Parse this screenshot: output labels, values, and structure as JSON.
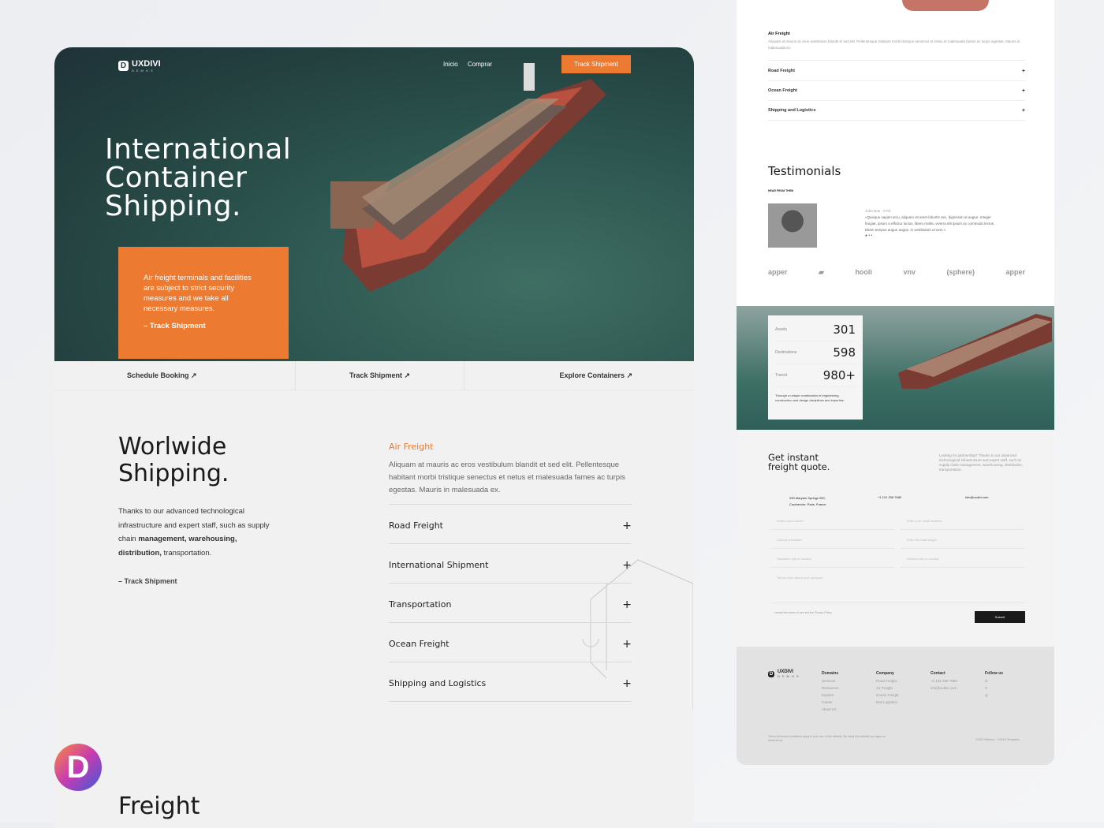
{
  "brand": {
    "name": "UXDIVI",
    "sub": "DEMOS"
  },
  "nav": {
    "items": [
      "Inicio",
      "Comprar"
    ],
    "cta": "Track Shipment"
  },
  "hero": {
    "title": [
      "International",
      "Container",
      "Shipping."
    ],
    "card_text": "Air freight terminals and facilities are subject to strict security measures and we take all necessary measures.",
    "card_link": "– Track Shipment"
  },
  "quick_links": [
    "Schedule Booking ↗",
    "Track Shipment ↗",
    "Explore Containers ↗"
  ],
  "worldwide": {
    "title": [
      "Worlwide",
      "Shipping."
    ],
    "text_pre": "Thanks to our advanced technological infrastructure and expert staff, such as supply chain ",
    "text_bold1": "management, warehousing, distribution,",
    "text_post": " transportation.",
    "link": "– Track Shipment"
  },
  "services": {
    "active": {
      "title": "Air Freight",
      "text": "Aliquam at mauris ac eros vestibulum blandit et sed elit. Pellentesque habitant morbi tristique senectus et netus et malesuada fames ac turpis egestas. Mauris in malesuada ex."
    },
    "items": [
      "Road Freight",
      "International Shipment",
      "Transportation",
      "Ocean Freight",
      "Shipping and Logistics"
    ]
  },
  "freight_heading": "Freight",
  "preview": {
    "accordion": {
      "active": "Air Freight",
      "text": "Aliquam at mauris ac eros vestibulum blandit et sed elit. Pellentesque habitant morbi tristique senectus et netus et malesuada fames ac turpis egestas. Mauris in malesuada ex.",
      "items": [
        "Road Freight",
        "Ocean Freight",
        "Shipping and Logistics"
      ]
    },
    "testimonials": {
      "title": "Testimonials",
      "eyebrow": "HEAR FROM THEM",
      "author": "John Doe · CTO",
      "quote": "«Quisque sapien arcu, aliquam sit amet lobortis nec, dignissim at augue. Integer feugiat, ipsum a efficitur luctus, libero mollis, viverra elit ipsum ac commodo lectus. Etiam tempus augue augue, in vestibulum ut sem.»",
      "logos": [
        "apper",
        "▰",
        "hooli",
        "vnv",
        "(sphere)",
        "apper"
      ]
    },
    "stats": [
      {
        "label": "Assets",
        "value": "301"
      },
      {
        "label": "Destinations",
        "value": "598"
      },
      {
        "label": "Transit",
        "value": "980+"
      }
    ],
    "stats_text": "Through a unique combination of engineering, construction and design disciplines and expertise.",
    "quote": {
      "title": [
        "Get instant",
        "freight quote."
      ],
      "intro": "Looking for partnership? Thanks to our advanced technological infrastructure and expert staff, such as supply chain management, warehousing, distribution, transportation.",
      "address": "290 Maryam Springs 260, Courbevoie, Paris, France",
      "phone": "+1 101 258 7680",
      "email": "info@uxdivi.com",
      "fields": [
        "What's your name?",
        "Enter your email address",
        "Choose a transfer",
        "Enter the total weight",
        "Departure city or country",
        "Delivery city or country"
      ],
      "message": "Tell us more about your transport",
      "consent": "I accept the terms of use and the Privacy Policy",
      "submit": "Submit"
    },
    "footer": {
      "cols": [
        {
          "title": "Domains",
          "items": [
            "Services",
            "Resources",
            "Explore",
            "Career",
            "About Us"
          ]
        },
        {
          "title": "Company",
          "items": [
            "Road Freight",
            "Air Freight",
            "Ocean Freight",
            "Rail Logistics"
          ]
        },
        {
          "title": "Contact",
          "items": [
            "+1 101 258 7680",
            "info@uxdivi.com"
          ]
        },
        {
          "title": "Follow us",
          "items": [
            "in",
            "X",
            "◎"
          ]
        }
      ],
      "legal": "These terms and conditions apply to your use of this website. By using this website you agree to these terms.",
      "copy": "©2023 Webone · UXDIVI Templates"
    }
  },
  "colors": {
    "accent": "#ec7a30",
    "hero": "#23403f",
    "dark": "#1a1a1a",
    "teal_icon": "#2bb3a0"
  }
}
